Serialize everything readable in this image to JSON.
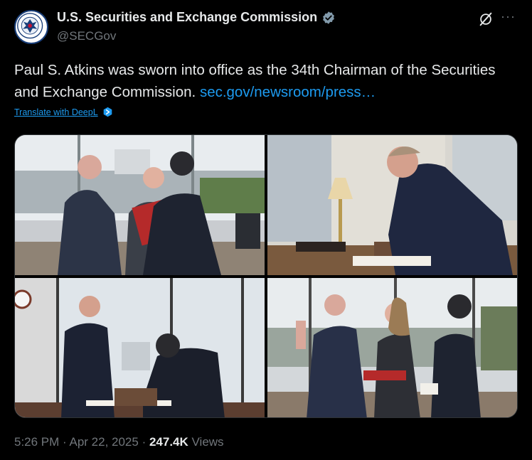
{
  "account": {
    "display_name": "U.S. Securities and Exchange Commission",
    "handle": "@SECGov",
    "verified_badge_icon": "verified-badge-icon",
    "verified_color": "#829aab"
  },
  "actions": {
    "grok_icon": "grok-icon",
    "more_label": "···"
  },
  "tweet": {
    "text": "Paul S. Atkins was sworn into office as the 34th Chairman of the Securities and Exchange Commission. ",
    "link_text": "sec.gov/newsroom/press…",
    "translate_label": "Translate with DeepL",
    "translate_icon": "deepl-icon"
  },
  "media": {
    "photos": [
      {
        "name": "photo-handshake"
      },
      {
        "name": "photo-signing-standing"
      },
      {
        "name": "photo-signing-seated"
      },
      {
        "name": "photo-oath"
      }
    ]
  },
  "meta": {
    "time": "5:26 PM",
    "separator": " · ",
    "date": "Apr 22, 2025",
    "views_count": "247.4K",
    "views_label": " Views"
  },
  "colors": {
    "background": "#000000",
    "text": "#e7e9ea",
    "secondary": "#71767b",
    "link": "#1d9bf0",
    "border": "#2f3336"
  }
}
